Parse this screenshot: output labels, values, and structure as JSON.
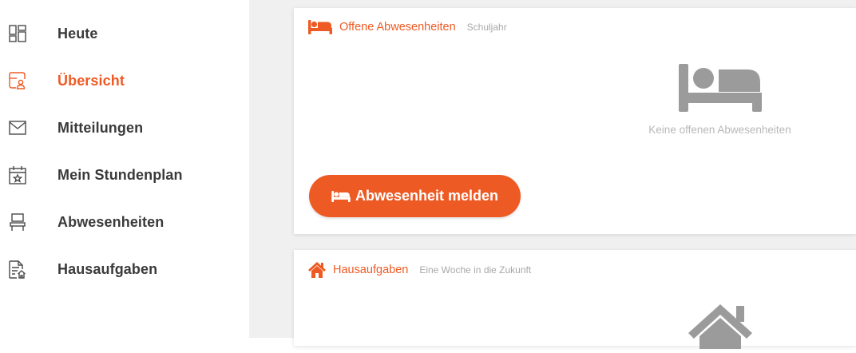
{
  "colors": {
    "accent": "#ee5a24",
    "text": "#3a3a3a",
    "muted": "#a8a8a8",
    "placeholder_icon": "#9b9b9b",
    "main_bg": "#f0f0f0"
  },
  "sidebar": {
    "items": [
      {
        "label": "Heute",
        "icon": "dashboard-grid-icon",
        "active": false
      },
      {
        "label": "Übersicht",
        "icon": "overview-profile-icon",
        "active": true
      },
      {
        "label": "Mitteilungen",
        "icon": "envelope-icon",
        "active": false
      },
      {
        "label": "Mein Stundenplan",
        "icon": "calendar-star-icon",
        "active": false
      },
      {
        "label": "Abwesenheiten",
        "icon": "chair-icon",
        "active": false
      },
      {
        "label": "Hausaufgaben",
        "icon": "document-home-icon",
        "active": false
      }
    ]
  },
  "absences_card": {
    "title": "Offene Abwesenheiten",
    "subtitle": "Schuljahr",
    "icon": "bed-icon",
    "empty_text": "Keine offenen Abwesenheiten",
    "empty_icon": "bed-icon",
    "button_label": "Abwesenheit melden",
    "button_icon": "bed-icon"
  },
  "homework_card": {
    "title": "Hausaufgaben",
    "subtitle": "Eine Woche in die Zukunft",
    "icon": "house-icon",
    "empty_icon": "house-icon"
  }
}
